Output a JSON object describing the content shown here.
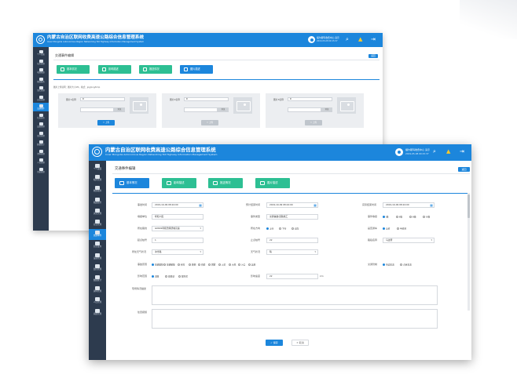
{
  "app": {
    "title": "内蒙古自治区联网收费高速公路综合信息管理系统",
    "subtitle": "Inner Mongolia Autonomous Region Networking Toll Highway Information Management System",
    "user_name": "福尔斯玛收费中心 演示",
    "user_time": "2019-05-08 09:15:37",
    "accent_color": "#1c86dc",
    "tab_color": "#2dbf93",
    "sidebar_color": "#2d3b4e"
  },
  "header_icons": [
    "search-icon",
    "bell-icon",
    "logout-icon"
  ],
  "sidebar": {
    "items": [
      {
        "label": "个人桌面",
        "icon": "home-icon"
      },
      {
        "label": "站务管理",
        "icon": "chat-icon"
      },
      {
        "label": "收费稽查",
        "icon": "headset-icon"
      },
      {
        "label": "路政服务",
        "icon": "card-icon"
      },
      {
        "label": "清欠管理",
        "icon": "info-icon"
      },
      {
        "label": "应急管理",
        "icon": "calendar-icon"
      },
      {
        "label": "交通事件",
        "icon": "truck-icon"
      },
      {
        "label": "信息发布",
        "icon": "monitor-icon"
      },
      {
        "label": "设备管理",
        "icon": "clipboard-icon"
      },
      {
        "label": "监控管理",
        "icon": "screen-icon"
      },
      {
        "label": "数据统计",
        "icon": "chart-icon"
      },
      {
        "label": "资料管理",
        "icon": "folder-icon"
      },
      {
        "label": "人员管理",
        "icon": "people-icon"
      },
      {
        "label": "系统管理",
        "icon": "gear-icon"
      }
    ],
    "active_index": 6
  },
  "page": {
    "title": "交通事件编辑",
    "back_label": "返回"
  },
  "tabs": [
    {
      "label": "基本情况"
    },
    {
      "label": "影响描述"
    },
    {
      "label": "推送情况"
    },
    {
      "label": "图片描述"
    }
  ],
  "back_window": {
    "active_tab": 3,
    "note": "图片上传说明：图片大小1M，格式：jpg/png/bmp",
    "cards": [
      {
        "label": "图片1名称",
        "value": "0",
        "browse": "浏览",
        "upload": "上传"
      },
      {
        "label": "图片2名称",
        "value": "0",
        "browse": "浏览",
        "upload": "上传"
      },
      {
        "label": "图片3名称",
        "value": "0",
        "browse": "浏览",
        "upload": "上传"
      }
    ]
  },
  "form": {
    "active_tab": 0,
    "occur_time_label": "事发时间",
    "occur_time": "2019-10-09 08:24:00",
    "plan_end_label": "预计结束时间",
    "plan_end": "2019-10-09 08:24:00",
    "actual_end_label": "实际结束时间",
    "actual_end": "2019-10-09 08:24:00",
    "reporter_label": "填报单位",
    "reporter": "呼和人民",
    "event_type_label": "事件类型",
    "event_type": "交通事故/道路施工",
    "level_label": "事件等级",
    "level_options": [
      "Ⅰ级",
      "Ⅱ级",
      "Ⅲ级",
      "Ⅳ级"
    ],
    "level_selected": 0,
    "road_label": "所在路线",
    "road": "G0601呼和浩特绕城高速",
    "direction_label": "所在方向",
    "direction_options": [
      "上行",
      "下行",
      "双向"
    ],
    "direction_selected": 0,
    "lane_status_label": "是否通车",
    "lane_status_options": [
      "全封",
      "半封闭"
    ],
    "lane_status_selected": 0,
    "start_km_label": "起点桩号",
    "start_km": "1",
    "end_km_label": "止点桩号",
    "end_km": "22",
    "location_label": "路段名称",
    "location": "乌达所",
    "weather_type_label": "所处天气状况",
    "weather_type": "冰雪路",
    "weather_label": "天气状况",
    "weather": "晴",
    "cause_label": "事故原因",
    "cause_options": [
      "车辆故障",
      "车辆碰撞",
      "积雪",
      "路侧",
      "桥梁",
      "团雾",
      "火灾",
      "大风",
      "沙尘",
      "其他"
    ],
    "cause_selected": 0,
    "release_label": "交通管制",
    "release_options": [
      "单边车道",
      "占用车道"
    ],
    "release_selected": 0,
    "control_label": "影响范围",
    "control_options": [
      "道路",
      "收费站",
      "服务区"
    ],
    "control_selected": 0,
    "speed_label": "影响速度",
    "speed": "22",
    "speed_unit": "km",
    "detail_label": "现场情况描述",
    "handle_label": "处置措施",
    "save_label": "保存",
    "cancel_label": "取消"
  }
}
